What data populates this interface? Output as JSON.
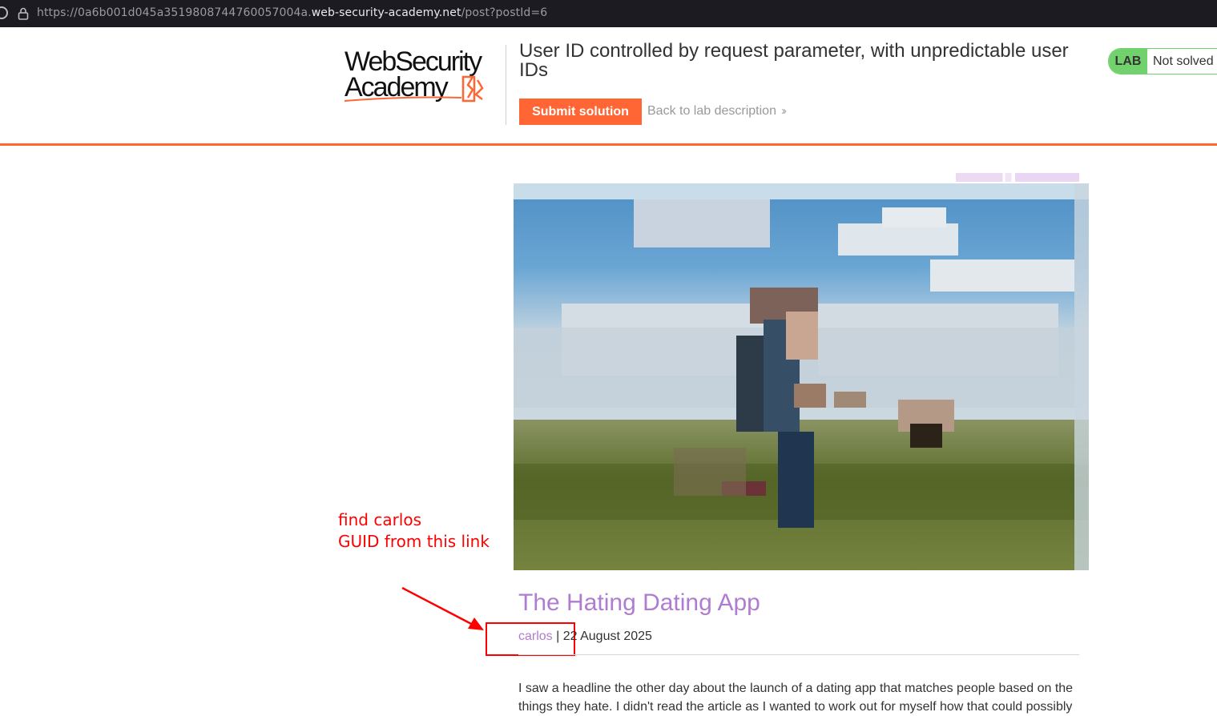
{
  "browser": {
    "url_prefix": "https://0a6b001d045a35198087447600570",
    "url_sub": "04a.",
    "url_host": "web-security-academy.net",
    "url_path": "/post?postId=6"
  },
  "header": {
    "logo_text": "WebSecurity Academy",
    "lab_title": "User ID controlled by request parameter, with unpredictable user IDs",
    "submit_label": "Submit solution",
    "back_label": "Back to lab description",
    "status_tag": "LAB",
    "status_text": "Not solved"
  },
  "annotation": {
    "line1": "find carlos",
    "line2": "GUID from this link"
  },
  "post": {
    "title": "The Hating Dating App",
    "author": "carlos",
    "separator": " | ",
    "date": "22 August 2025",
    "body": "I saw a headline the other day about the launch of a dating app that matches people based on the things they hate. I didn't read the article as I wanted to work out for myself how that could possibly"
  },
  "colors": {
    "accent": "#ff6633",
    "lab_green": "#70d16d",
    "link_purple": "#b07ccf",
    "annotation_red": "#ff0000"
  }
}
